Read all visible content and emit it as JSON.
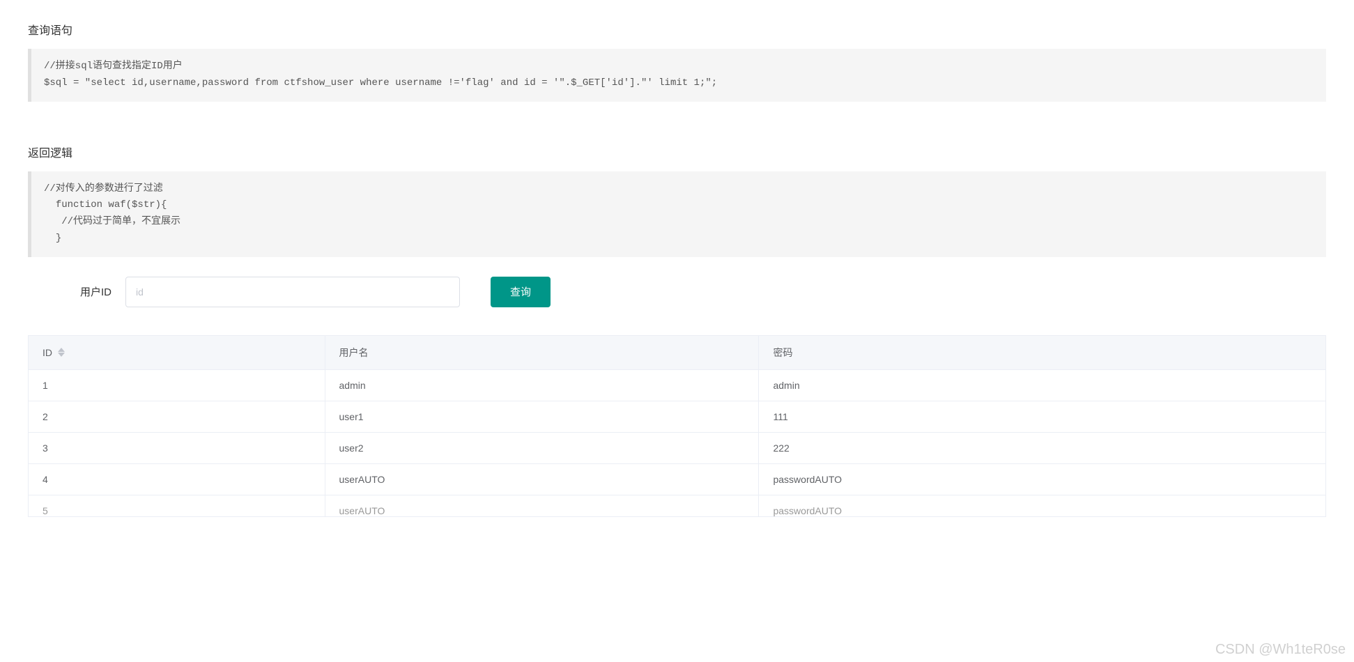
{
  "sections": {
    "query": {
      "title": "查询语句",
      "code": "//拼接sql语句查找指定ID用户\n$sql = \"select id,username,password from ctfshow_user where username !='flag' and id = '\".$_GET['id'].\"' limit 1;\";"
    },
    "logic": {
      "title": "返回逻辑",
      "code": "//对传入的参数进行了过滤\n  function waf($str){\n   //代码过于简单，不宜展示\n  }"
    }
  },
  "form": {
    "label": "用户ID",
    "placeholder": "id",
    "button_label": "查询"
  },
  "table": {
    "columns": {
      "id": "ID",
      "username": "用户名",
      "password": "密码"
    },
    "rows": [
      {
        "id": "1",
        "username": "admin",
        "password": "admin"
      },
      {
        "id": "2",
        "username": "user1",
        "password": "111"
      },
      {
        "id": "3",
        "username": "user2",
        "password": "222"
      },
      {
        "id": "4",
        "username": "userAUTO",
        "password": "passwordAUTO"
      },
      {
        "id": "5",
        "username": "userAUTO",
        "password": "passwordAUTO"
      }
    ]
  },
  "watermark": "CSDN @Wh1teR0se"
}
